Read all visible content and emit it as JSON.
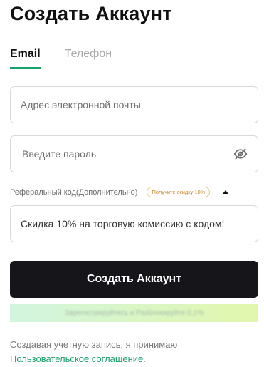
{
  "header": {
    "title": "Создать Аккаунт"
  },
  "tabs": [
    {
      "label": "Email",
      "active": true
    },
    {
      "label": "Телефон",
      "active": false
    }
  ],
  "form": {
    "email_placeholder": "Адрес электронной почты",
    "password_placeholder": "Введите пароль",
    "password_toggle_icon": "eye-off-icon",
    "referral_label": "Реферальный код(Дополнительно)",
    "referral_badge": "Получите скидку 10%",
    "referral_toggle_icon": "caret-up-icon",
    "referral_value": "Скидка 10% на торговую комиссию с кодом!",
    "submit_label": "Создать Аккаунт"
  },
  "promo": {
    "text": "Зарегистрируйтесь и Разблокируйте 0,1%"
  },
  "footer": {
    "consent_text": "Создавая учетную запись, я принимаю",
    "agreement_link": "Пользовательское соглашение",
    "period": "."
  },
  "colors": {
    "accent": "#1aa06b",
    "button": "#16161a",
    "badge": "#c98a2c",
    "promo_gradient_start": "#d2f5df",
    "promo_gradient_end": "#e2f7ad"
  }
}
